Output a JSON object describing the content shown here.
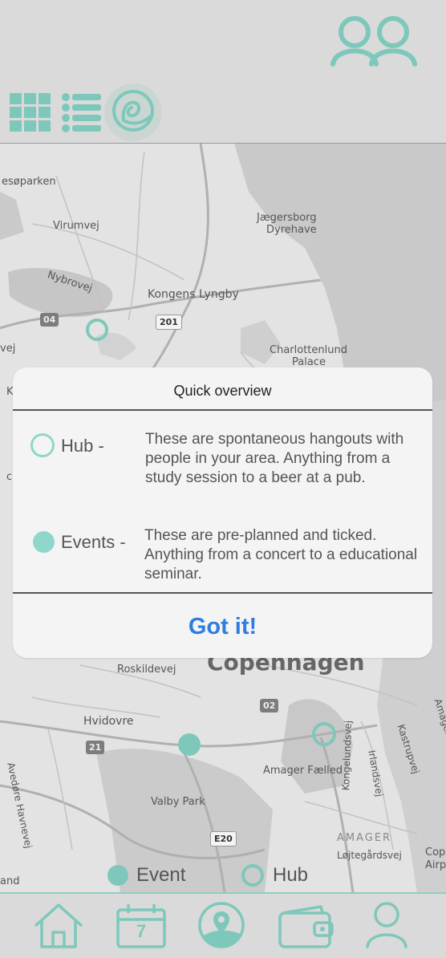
{
  "header": {
    "friends_icon": "people-icon"
  },
  "view_switch": [
    {
      "name": "grid-view",
      "icon": "grid-icon"
    },
    {
      "name": "list-view",
      "icon": "list-icon"
    },
    {
      "name": "map-view",
      "icon": "map-pin-icon",
      "active": true
    }
  ],
  "map": {
    "labels": {
      "l1": "esøparken",
      "l2": "Virumvej",
      "l3": "Nybrovej",
      "l4": "Kongens Lyngby",
      "l5": "Jægersborg",
      "l6": "Dyrehave",
      "l7": "Charlottenlund",
      "l8": "Palace",
      "l9": "vej",
      "l10": "Copenhagen",
      "l11": "Roskildevej",
      "l12": "Hvidovre",
      "l13": "Avedøre Havnevej",
      "l14": "Amager Fælled",
      "l15": "Valby Park",
      "l16": "AMAGER",
      "l17": "Løjtegårdsvej",
      "l18": "Kongelundsvej",
      "l19": "Irlandsvej",
      "l20": "Kastrupvej",
      "l21": "Amager Strand",
      "l22": "and",
      "l23": "Cop",
      "l24": "Airp",
      "l25": "K",
      "l26": "c"
    },
    "roads": {
      "r1": "04",
      "r2": "201",
      "r3": "02",
      "r4": "21",
      "r5": "E20"
    },
    "legend": {
      "event": "Event",
      "hub": "Hub"
    }
  },
  "dialog": {
    "title": "Quick overview",
    "hub_label": "Hub -",
    "hub_text": "These are spontaneous hangouts with people in your area. Anything from a study session to a beer at a pub.",
    "events_label": "Events -",
    "events_text": "These are pre-planned and ticked. Anything from a concert to a educational seminar.",
    "confirm": "Got it!"
  },
  "tabbar": {
    "calendar_day": "7",
    "items": [
      "home-icon",
      "calendar-icon",
      "map-icon",
      "wallet-icon",
      "profile-icon"
    ]
  },
  "colors": {
    "accent": "#7ec8bb",
    "link": "#2e7de0"
  }
}
